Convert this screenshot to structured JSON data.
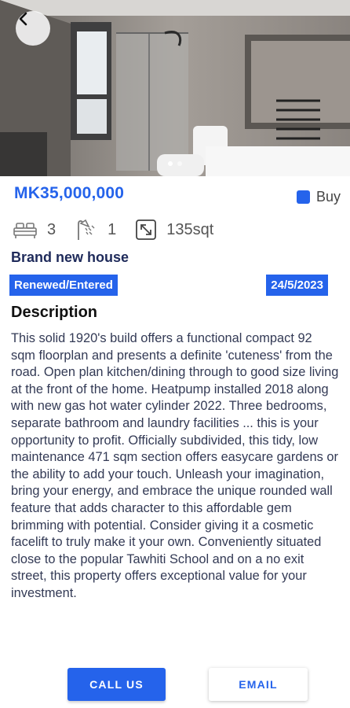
{
  "listing": {
    "price": "MK35,000,000",
    "type_label": "Buy",
    "bedrooms": "3",
    "bathrooms": "1",
    "area": "135sqt",
    "title": "Brand new house",
    "status": "Renewed/Entered",
    "date": "24/5/2023",
    "description_heading": "Description",
    "description": "This solid 1920's build offers a functional compact 92 sqm floorplan and presents a definite 'cuteness' from the road. Open plan kitchen/dining through to good size living at the front of the home. Heatpump installed 2018 along with new gas hot water cylinder 2022. Three bedrooms, separate bathroom and laundry facilities ... this is your opportunity to profit. Officially subdivided, this tidy, low maintenance 471 sqm section offers easycare gardens or the ability to add your touch. Unleash your imagination, bring your energy, and embrace the unique rounded wall feature that adds character to this affordable gem brimming with potential. Consider giving it a cosmetic facelift to truly make it your own. Conveniently situated close to the popular Tawhiti School and on a no exit street, this property offers exceptional value for your investment."
  },
  "actions": {
    "call_label": "CALL US",
    "email_label": "EMAIL"
  },
  "icons": {
    "back": "arrow-left-icon",
    "bed": "bed-icon",
    "shower": "shower-icon",
    "area": "resize-arrow-icon"
  },
  "colors": {
    "accent": "#2563eb",
    "title": "#1e2a5a"
  }
}
